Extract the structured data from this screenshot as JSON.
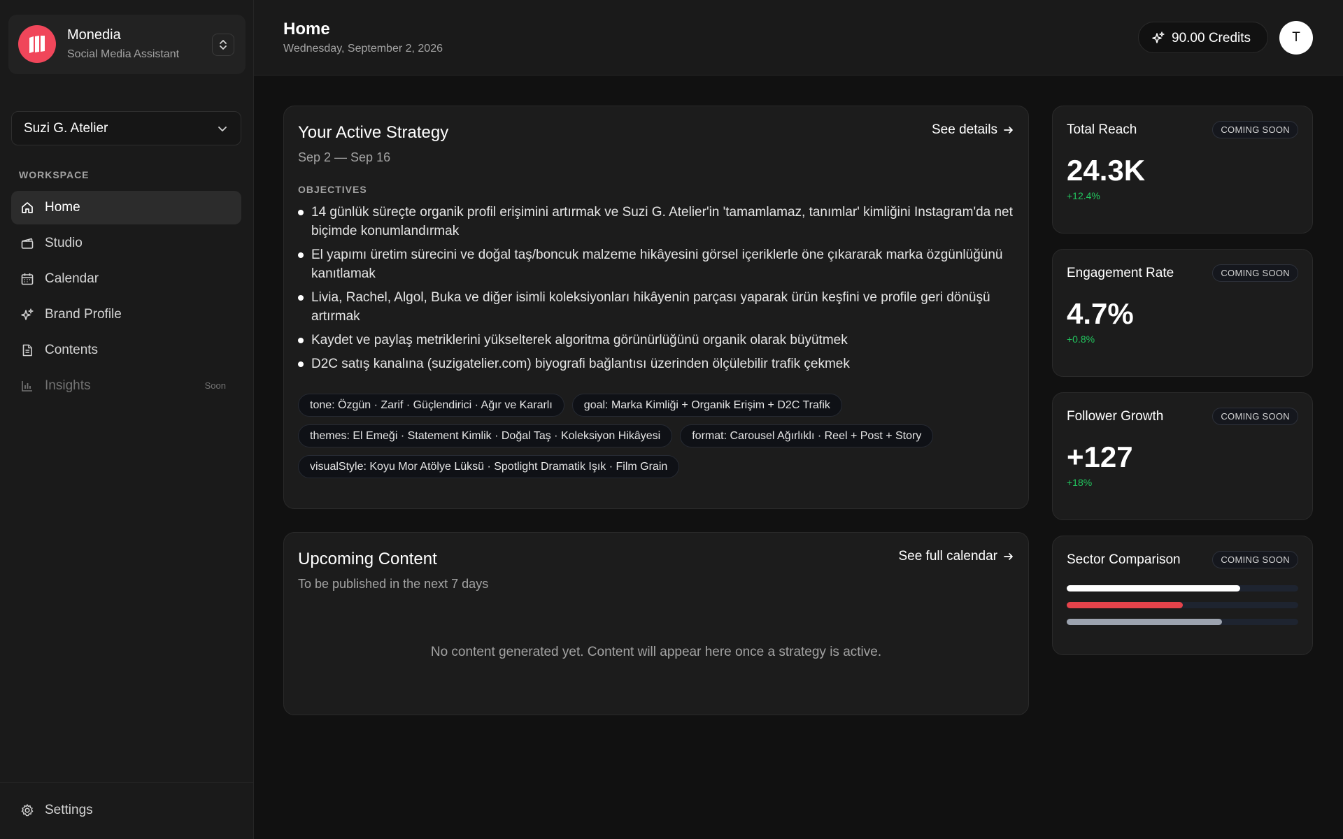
{
  "app": {
    "name": "Monedia",
    "subtitle": "Social Media Assistant"
  },
  "brand_selector": {
    "selected": "Suzi G. Atelier"
  },
  "sidebar": {
    "section_label": "WORKSPACE",
    "items": [
      {
        "label": "Home",
        "icon": "home-icon",
        "active": true
      },
      {
        "label": "Studio",
        "icon": "clapperboard-icon"
      },
      {
        "label": "Calendar",
        "icon": "calendar-icon"
      },
      {
        "label": "Brand Profile",
        "icon": "sparkles-icon"
      },
      {
        "label": "Contents",
        "icon": "document-icon"
      },
      {
        "label": "Insights",
        "icon": "bar-chart-icon",
        "disabled": true,
        "badge": "Soon"
      }
    ],
    "settings_label": "Settings"
  },
  "header": {
    "title": "Home",
    "date": "Wednesday, September 2, 2026",
    "credits": "90.00 Credits",
    "avatar_initial": "T"
  },
  "strategy": {
    "title": "Your Active Strategy",
    "link": "See details",
    "date_range": "Sep 2 — Sep 16",
    "objectives_label": "OBJECTIVES",
    "objectives": [
      "14 günlük süreçte organik profil erişimini artırmak ve Suzi G. Atelier'in 'tamamlamaz, tanımlar' kimliğini Instagram'da net biçimde konumlandırmak",
      "El yapımı üretim sürecini ve doğal taş/boncuk malzeme hikâyesini görsel içeriklerle öne çıkararak marka özgünlüğünü kanıtlamak",
      "Livia, Rachel, Algol, Buka ve diğer isimli koleksiyonları hikâyenin parçası yaparak ürün keşfini ve profile geri dönüşü artırmak",
      "Kaydet ve paylaş metriklerini yükselterek algoritma görünürlüğünü organik olarak büyütmek",
      "D2C satış kanalına (suzigatelier.com) biyografi bağlantısı üzerinden ölçülebilir trafik çekmek"
    ],
    "tags": [
      "tone: Özgün · Zarif · Güçlendirici · Ağır ve Kararlı",
      "goal: Marka Kimliği + Organik Erişim + D2C Trafik",
      "themes: El Emeği · Statement Kimlik · Doğal Taş · Koleksiyon Hikâyesi",
      "format: Carousel Ağırlıklı · Reel + Post + Story",
      "visualStyle: Koyu Mor Atölye Lüksü · Spotlight Dramatik Işık · Film Grain"
    ]
  },
  "upcoming": {
    "title": "Upcoming Content",
    "link": "See full calendar",
    "subtitle": "To be published in the next 7 days",
    "empty_message": "No content generated yet. Content will appear here once a strategy is active."
  },
  "metrics": [
    {
      "title": "Total Reach",
      "badge": "COMING SOON",
      "value": "24.3K",
      "delta": "+12.4%"
    },
    {
      "title": "Engagement Rate",
      "badge": "COMING SOON",
      "value": "4.7%",
      "delta": "+0.8%"
    },
    {
      "title": "Follower Growth",
      "badge": "COMING SOON",
      "value": "+127",
      "delta": "+18%"
    }
  ],
  "sector": {
    "title": "Sector Comparison",
    "badge": "COMING SOON",
    "bars": [
      {
        "fraction": 0.75,
        "color": "#ffffff"
      },
      {
        "fraction": 0.5,
        "color": "#e5434b"
      },
      {
        "fraction": 0.67,
        "color": "#9ca3af"
      }
    ]
  },
  "colors": {
    "accent": "#f0465a",
    "positive": "#22c55e"
  }
}
